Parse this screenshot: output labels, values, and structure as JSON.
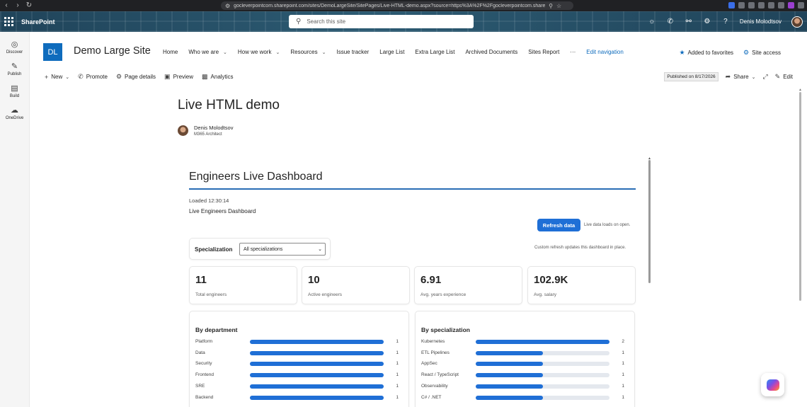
{
  "browser": {
    "url": "gocleverpointcom.sharepoint.com/sites/DemoLargeSite/SitePages/Live-HTML-demo.aspx?source=https%3A%2F%2Fgocleverpointcom.sharepoint.com%..."
  },
  "suite": {
    "app_name": "SharePoint",
    "search_placeholder": "Search this site",
    "user_name": "Denis Molodtsov"
  },
  "app_bar": {
    "items": [
      {
        "label": "Discover",
        "icon": "compass-icon"
      },
      {
        "label": "Publish",
        "icon": "pen-icon"
      },
      {
        "label": "Build",
        "icon": "build-icon"
      },
      {
        "label": "OneDrive",
        "icon": "cloud-icon"
      }
    ]
  },
  "site": {
    "logo_initials": "DL",
    "title": "Demo Large Site",
    "nav": [
      {
        "label": "Home",
        "dropdown": false
      },
      {
        "label": "Who we are",
        "dropdown": true
      },
      {
        "label": "How we work",
        "dropdown": true
      },
      {
        "label": "Resources",
        "dropdown": true
      },
      {
        "label": "Issue tracker",
        "dropdown": false
      },
      {
        "label": "Large List",
        "dropdown": false
      },
      {
        "label": "Extra Large List",
        "dropdown": false
      },
      {
        "label": "Archived Documents",
        "dropdown": false
      },
      {
        "label": "Sites Report",
        "dropdown": false
      },
      {
        "label": "···",
        "dropdown": false
      }
    ],
    "edit_navigation": "Edit navigation",
    "favorites": "Added to favorites",
    "site_access": "Site access"
  },
  "command_bar": {
    "new": "New",
    "promote": "Promote",
    "page_details": "Page details",
    "preview": "Preview",
    "analytics": "Analytics",
    "published": "Published on 8/17/2026",
    "share": "Share",
    "edit": "Edit"
  },
  "page": {
    "title": "Live HTML demo",
    "author_name": "Denis Molodtsov",
    "author_role": "M365 Architect"
  },
  "dashboard": {
    "title": "Engineers Live Dashboard",
    "loaded": "Loaded 12:30:14",
    "subtitle": "Live Engineers Dashboard",
    "refresh_button": "Refresh data",
    "refresh_note": "Live data loads on open.",
    "filter_label": "Specialization",
    "filter_value": "All specializations",
    "custom_note": "Custom refresh updates this dashboard in place.",
    "stats": [
      {
        "value": "11",
        "label": "Total engineers"
      },
      {
        "value": "10",
        "label": "Active engineers"
      },
      {
        "value": "6.91",
        "label": "Avg. years experience"
      },
      {
        "value": "102.9K",
        "label": "Avg. salary"
      }
    ]
  },
  "accent_color": "#1f6fd6",
  "chart_data": [
    {
      "type": "bar",
      "title": "By department",
      "categories": [
        "Platform",
        "Data",
        "Security",
        "Frontend",
        "SRE",
        "Backend"
      ],
      "values": [
        1,
        1,
        1,
        1,
        1,
        1
      ],
      "max": 1
    },
    {
      "type": "bar",
      "title": "By specialization",
      "categories": [
        "Kubernetes",
        "ETL Pipelines",
        "AppSec",
        "React / TypeScript",
        "Observability",
        "C# / .NET"
      ],
      "values": [
        2,
        1,
        1,
        1,
        1,
        1
      ],
      "max": 2
    }
  ]
}
